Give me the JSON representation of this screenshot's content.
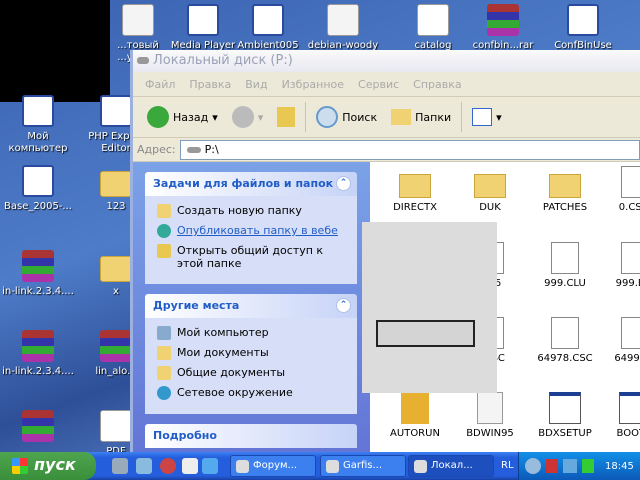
{
  "desktop": {
    "icons": [
      {
        "label": "...товый ...умент",
        "type": "doc"
      },
      {
        "label": "Media Player",
        "type": "app"
      },
      {
        "label": "Ambient005",
        "type": "app"
      },
      {
        "label": "debian-woody",
        "type": "doc"
      },
      {
        "label": "catalog",
        "type": "red"
      },
      {
        "label": "confbin...rar",
        "type": "rar"
      },
      {
        "label": "ConfBinUse",
        "type": "app"
      },
      {
        "label": "Мой компьютер",
        "type": "app"
      },
      {
        "label": "PHP Expert Editor",
        "type": "app"
      },
      {
        "label": "Base_2005-...",
        "type": "app"
      },
      {
        "label": "123",
        "type": "fold"
      },
      {
        "label": "in-link.2.3.4....",
        "type": "rar"
      },
      {
        "label": "x",
        "type": "fold"
      },
      {
        "label": "in-link.2.3.4....",
        "type": "rar"
      },
      {
        "label": "lin_alo...",
        "type": "rar"
      },
      {
        "label": "",
        "type": "rar"
      },
      {
        "label": "PDF",
        "type": "red"
      }
    ]
  },
  "window": {
    "title": "Локальный диск (P:)",
    "menu": [
      "Файл",
      "Правка",
      "Вид",
      "Избранное",
      "Сервис",
      "Справка"
    ],
    "toolbar": {
      "back": "Назад",
      "search": "Поиск",
      "folders": "Папки"
    },
    "address": {
      "label": "Адрес:",
      "value": "P:\\"
    },
    "tasks": {
      "title": "Задачи для файлов и папок",
      "items": [
        "Создать новую папку",
        "Опубликовать папку в вебе",
        "Открыть общий доступ к этой папке"
      ]
    },
    "places": {
      "title": "Другие места",
      "items": [
        "Мой компьютер",
        "Мои документы",
        "Общие документы",
        "Сетевое окружение"
      ]
    },
    "details": {
      "title": "Подробно"
    },
    "files": [
      {
        "name": "DIRECTX",
        "type": "folder"
      },
      {
        "name": "DUK",
        "type": "folder"
      },
      {
        "name": "PATCHES",
        "type": "folder"
      },
      {
        "name": "0.CS...",
        "type": "app"
      },
      {
        "name": "",
        "type": "app"
      },
      {
        "name": "...56",
        "type": "app"
      },
      {
        "name": "999.CLU",
        "type": "app"
      },
      {
        "name": "999.B...",
        "type": "app"
      },
      {
        "name": "",
        "type": "app"
      },
      {
        "name": "...CSC",
        "type": "app"
      },
      {
        "name": "64978.CSC",
        "type": "app"
      },
      {
        "name": "64990...",
        "type": "app"
      },
      {
        "name": "AUTORUN",
        "type": "setup"
      },
      {
        "name": "BDWIN95",
        "type": "doc"
      },
      {
        "name": "BDXSETUP",
        "type": "window"
      },
      {
        "name": "BOOT...",
        "type": "window"
      }
    ]
  },
  "taskbar": {
    "start": "пуск",
    "tasks": [
      "Форум...",
      "Garfis...",
      "Локал..."
    ],
    "lang": "RL",
    "clock": "18:45"
  }
}
